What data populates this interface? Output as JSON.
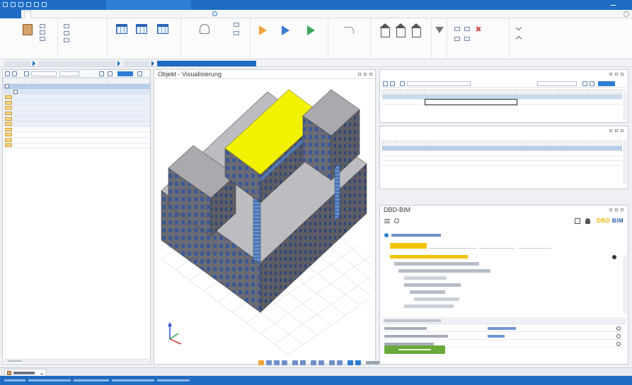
{
  "window": {
    "title": "",
    "context_tab": "",
    "accent_color": "#1f6cc2",
    "highlight_color": "#f2c200"
  },
  "ribbon": {
    "tabs": [
      {
        "label": "",
        "type": "file"
      },
      {
        "label": "",
        "active": true
      },
      {
        "label": ""
      },
      {
        "label": ""
      },
      {
        "label": ""
      },
      {
        "label": ""
      }
    ],
    "help_label": ""
  },
  "left_panel": {
    "columns": [
      "",
      "",
      "",
      ""
    ],
    "rows": [
      {
        "lvl": "",
        "name": "",
        "amount": ""
      },
      {
        "lvl": "",
        "name": "",
        "amount": ""
      },
      {
        "lvl": "",
        "name": "",
        "amount": ""
      },
      {
        "lvl": "",
        "name": "",
        "amount": ""
      },
      {
        "lvl": "",
        "name": "",
        "amount": ""
      },
      {
        "lvl": "",
        "name": "",
        "amount": ""
      },
      {
        "lvl": "",
        "name": "",
        "amount": ""
      },
      {
        "lvl": "",
        "name": "",
        "amount": ""
      },
      {
        "lvl": "",
        "name": "",
        "amount": ""
      },
      {
        "lvl": "",
        "name": "",
        "amount": ""
      },
      {
        "lvl": "",
        "name": "",
        "amount": ""
      },
      {
        "lvl": "",
        "name": "",
        "amount": ""
      }
    ]
  },
  "view3d": {
    "title": "Objekt - Visualisierung",
    "roof_highlight": "#f2f200",
    "facade": "#6f6f78",
    "window_color": "#3c5a96"
  },
  "assigned_panel": {
    "title": "",
    "columns": [
      "",
      "",
      "",
      "",
      "",
      "",
      ""
    ],
    "rows": [
      {
        "cells": [
          "",
          "",
          "",
          "",
          "",
          "",
          ""
        ]
      },
      {
        "cells": [
          "",
          "",
          "",
          "",
          "",
          "",
          ""
        ]
      }
    ]
  },
  "recipe_panel": {
    "title": "",
    "columns": [
      "",
      "",
      "",
      "",
      "",
      "",
      ""
    ],
    "rows": [
      {
        "cells": [
          "",
          "",
          "",
          "",
          "",
          "",
          ""
        ]
      },
      {
        "cells": [
          "",
          "",
          "",
          "",
          "",
          "",
          ""
        ]
      },
      {
        "cells": [
          "",
          "",
          "",
          "",
          "",
          "",
          ""
        ]
      },
      {
        "cells": [
          "",
          "",
          "",
          "",
          "",
          "",
          ""
        ]
      }
    ]
  },
  "dbd_panel": {
    "title": "DBD-BIM",
    "logo_a": "DBD",
    "logo_b": "BIM"
  },
  "doc_tab": {
    "label": ""
  },
  "breadcrumb": []
}
